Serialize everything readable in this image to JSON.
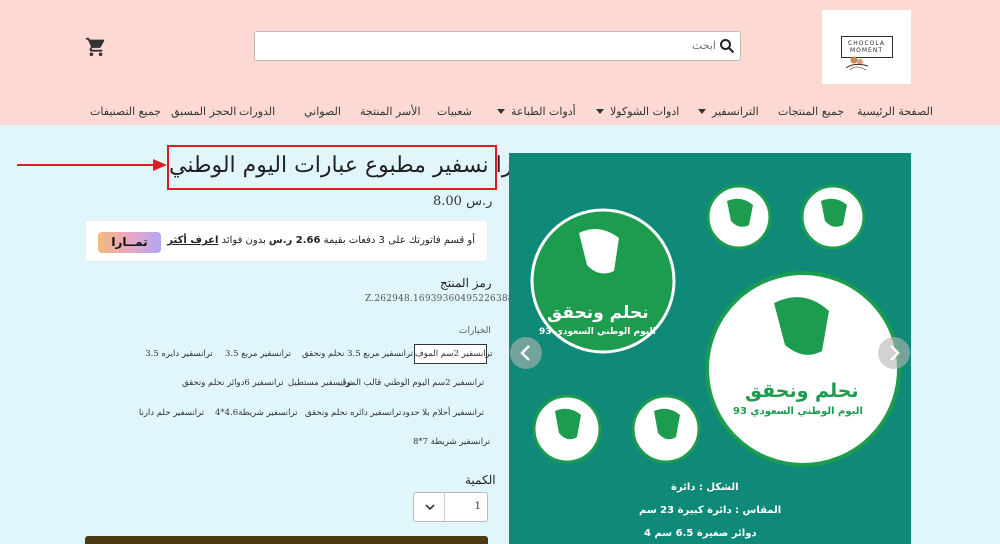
{
  "header": {
    "logo": {
      "line1": "CHOCOLA",
      "line2": "MOMENT"
    },
    "search": {
      "placeholder": "ابحث"
    },
    "nav": [
      {
        "label": "الصفحة الرئيسية"
      },
      {
        "label": "جميع المنتجات"
      },
      {
        "label": "الترانسفير"
      },
      {
        "label": "ادوات الشوكولا"
      },
      {
        "label": "أدوات الطباعة"
      },
      {
        "label": "شعبيات"
      },
      {
        "label": "الأسر المنتجة"
      },
      {
        "label": "الصواني"
      },
      {
        "label": "الدورات"
      },
      {
        "label": "الحجز المسبق"
      },
      {
        "label": "جميع التصنيفات"
      }
    ]
  },
  "product": {
    "title": "ورق ترا نسفير مطبوع عبارات اليوم الوطني",
    "price": "8.00 ر.س",
    "tamara": {
      "logo": "تمــارا",
      "text_before": "أو قسم فاتورتك على 3 دفعات بقيمة ",
      "amount": "2.66 ر.س",
      "text_after": " بدون فوائد ",
      "link": "اعرف أكثر"
    },
    "sku_label": "رمز المنتج",
    "sku": "Z.262948.1693936049522638883",
    "options_label": "الخيارات",
    "options": [
      "ترانسفير 2سم الموف",
      "ترانسفير مربع 3.5 نحلم ونحقق",
      "ترانسفير مربع 3.5",
      "ترانسفير دايره 3.5",
      "ترانسفير 2سم اليوم الوطني قالب الموف",
      "ترانسفير مستطيل",
      "ترانسفير 6دوائر نحلم ونحقق",
      "ترانسفير أحلام بلا حدود",
      "ترانسفير دائره نحلم ونحقق",
      "ترانسفير شريطة4.6*4",
      "ترانسفير حلم دارنا",
      "ترانسفير شريطة 7*8"
    ],
    "quantity_label": "الكمية",
    "quantity": "1"
  },
  "image": {
    "slogan": "نحلم ونحقق",
    "subtitle": "اليوم الوطني السعودي 93",
    "spec_shape": "الشكل : دائرة",
    "spec_size": "المقاس : دائرة كبيرة 23 سم",
    "spec_small": "4 دوائر صغيرة 6.5 سم"
  },
  "colors": {
    "header_bg": "#fcd9d3",
    "page_bg": "#e0f6fb",
    "annotation_red": "#e01b24",
    "image_teal": "#0f8a78",
    "circle_green": "#1d9b4e"
  }
}
